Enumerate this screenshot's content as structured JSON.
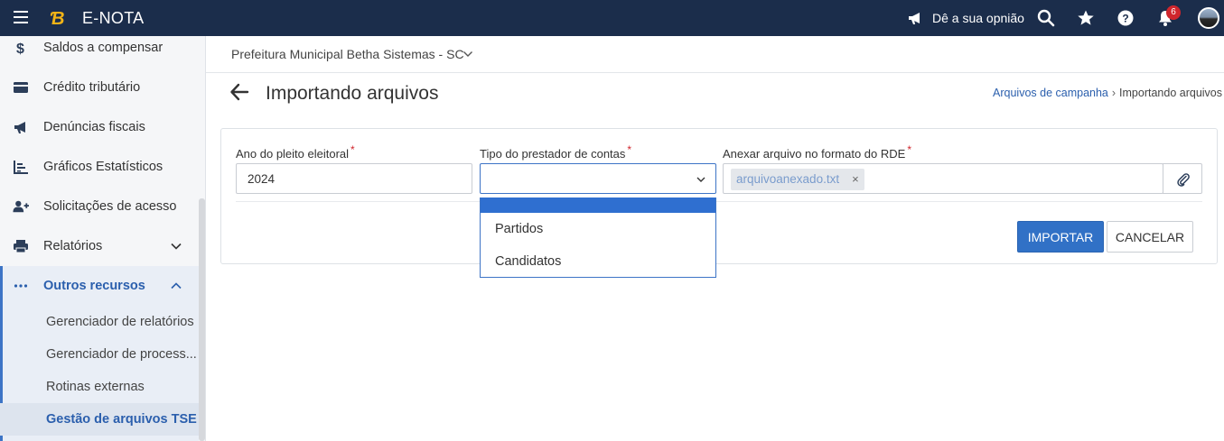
{
  "app": {
    "title": "E-NOTA",
    "feedback_label": "Dê a sua opnião",
    "notifications_count": "6"
  },
  "icons": {
    "menu": "hamburger-icon",
    "logo": "betha-logo",
    "feedback": "megaphone-icon",
    "search": "search-icon",
    "favorites": "star-icon",
    "help": "help-icon",
    "notifications": "bell-icon",
    "avatar": "user-avatar"
  },
  "colors": {
    "topbar": "#1b2d4b",
    "accent": "#3171c6",
    "active_text": "#2b5fad",
    "required": "#d0262d"
  },
  "sidebar": {
    "items": [
      {
        "label": "Saldos a compensar",
        "icon": "dollar-icon"
      },
      {
        "label": "Crédito tributário",
        "icon": "credit-card-icon"
      },
      {
        "label": "Denúncias fiscais",
        "icon": "megaphone-icon"
      },
      {
        "label": "Gráficos Estatísticos",
        "icon": "chart-icon"
      },
      {
        "label": "Solicitações de acesso",
        "icon": "user-plus-icon"
      },
      {
        "label": "Relatórios",
        "icon": "printer-icon"
      },
      {
        "label": "Outros recursos",
        "icon": "more-icon"
      }
    ],
    "sub_items": [
      {
        "label": "Gerenciador de relatórios"
      },
      {
        "label": "Gerenciador de process..."
      },
      {
        "label": "Rotinas externas"
      },
      {
        "label": "Gestão de arquivos TSE"
      }
    ]
  },
  "header": {
    "organization": "Prefeitura Municipal Betha Sistemas - SC",
    "page_title": "Importando arquivos",
    "breadcrumb": {
      "parent": "Arquivos de campanha",
      "current": "Importando arquivos"
    }
  },
  "form": {
    "year": {
      "label": "Ano do pleito eleitoral",
      "required_mark": "*",
      "value": "2024"
    },
    "provider_type": {
      "label": "Tipo do prestador de contas",
      "required_mark": "*",
      "value": "",
      "options": [
        "Partidos",
        "Candidatos"
      ]
    },
    "file": {
      "label": "Anexar arquivo no formato do RDE",
      "required_mark": "*",
      "attached_file": "arquivoanexado.txt",
      "remove_symbol": "×",
      "attach_icon": "paperclip-icon"
    },
    "import_button": "IMPORTAR",
    "cancel_button": "CANCELAR"
  }
}
